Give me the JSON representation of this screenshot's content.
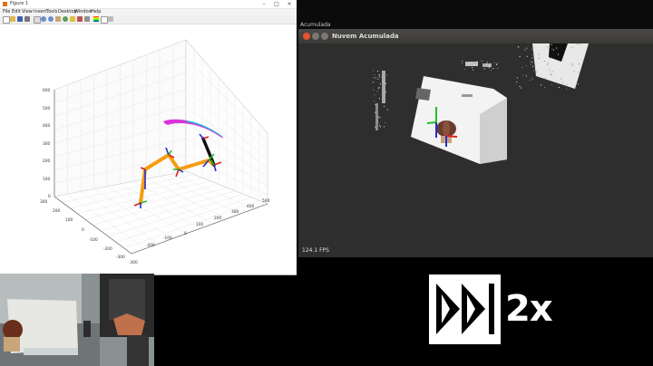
{
  "figure": {
    "title": "Figure 1",
    "menus": [
      "File",
      "Edit",
      "View",
      "Insert",
      "Tools",
      "Desktop",
      "Window",
      "Help"
    ],
    "toolbar_icons": [
      "new-file-icon",
      "open-icon",
      "save-icon",
      "print-icon",
      "arrow-icon",
      "zoom-in-icon",
      "zoom-out-icon",
      "pan-icon",
      "rotate-icon",
      "datatip-icon",
      "brush-icon",
      "link-icon",
      "insert-colorbar-icon",
      "insert-legend-icon",
      "hide-plot-tools-icon"
    ],
    "z_ticks": [
      "600",
      "500",
      "400",
      "300",
      "200",
      "100",
      "0"
    ],
    "y_ticks": [
      "300",
      "200",
      "100",
      "0",
      "-100",
      "-200",
      "-300"
    ],
    "x_ticks": [
      "-300",
      "-200",
      "-100",
      "0",
      "100",
      "200",
      "300",
      "400",
      "500"
    ]
  },
  "desktop": {
    "truncated_label": "Acumulada"
  },
  "nuvem": {
    "title": "Nuvem Acumulada",
    "fps": "124.1 FPS"
  },
  "speed": {
    "label": "2x",
    "icon": "fast-forward-icon"
  },
  "colors": {
    "arm_orange": "#f59d12",
    "trajectory_magenta": "#d932d9",
    "trajectory_cyan": "#2ab7d8",
    "axis_red": "#e02020",
    "axis_green": "#20c020",
    "axis_blue": "#2030d0"
  }
}
